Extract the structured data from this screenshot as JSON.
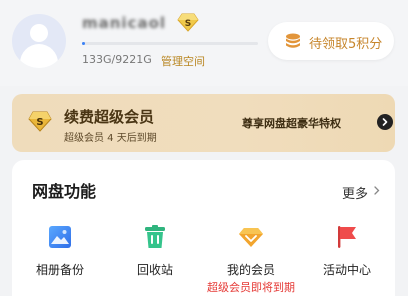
{
  "profile": {
    "username": "manicaol",
    "storage_used_percent": 1.5,
    "storage_text": "133G/9221G",
    "manage_label": "管理空间",
    "points_button": "待领取5积分"
  },
  "vip": {
    "title": "续费超级会员",
    "subtitle": "超级会员 4 天后到期",
    "privilege": "尊享网盘超豪华特权"
  },
  "features": {
    "title": "网盘功能",
    "more": "更多",
    "items": [
      {
        "label": "相册备份",
        "icon": "photo-album-icon"
      },
      {
        "label": "回收站",
        "icon": "recycle-bin-icon"
      },
      {
        "label": "我的会员",
        "icon": "diamond-icon",
        "hint": "超级会员即将到期"
      },
      {
        "label": "活动中心",
        "icon": "flag-icon"
      }
    ]
  },
  "colors": {
    "accent_gold": "#b98723",
    "alert_red": "#e53935",
    "storage_blue": "#3b82f6"
  }
}
